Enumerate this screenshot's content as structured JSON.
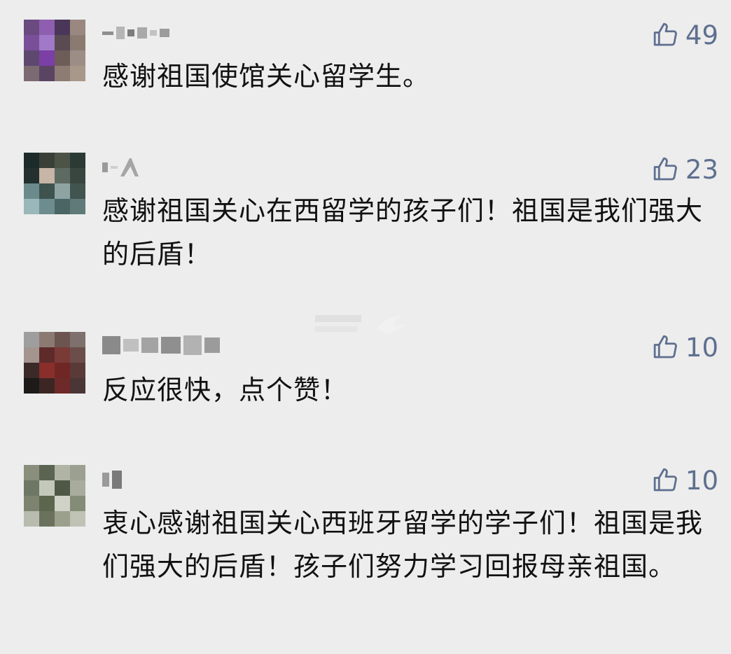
{
  "comments": [
    {
      "username": "",
      "likes": "49",
      "text": "感谢祖国使馆关心留学生。"
    },
    {
      "username": "",
      "likes": "23",
      "text": "感谢祖国关心在西留学的孩子们！祖国是我们强大的后盾！"
    },
    {
      "username": "",
      "likes": "10",
      "text": "反应很快，点个赞！"
    },
    {
      "username": "",
      "likes": "10",
      "text": "衷心感谢祖国关心西班牙留学的学子们！祖国是我们强大的后盾！孩子们努力学习回报母亲祖国。"
    }
  ],
  "icons": {
    "like": "thumbs-up-icon"
  },
  "colors": {
    "background": "#ededed",
    "like_color": "#5f6f8f",
    "text_color": "#111111"
  }
}
